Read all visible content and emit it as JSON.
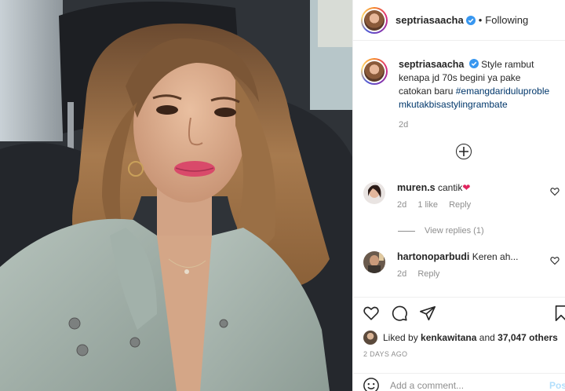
{
  "post": {
    "author": "septriasaacha",
    "verified": true,
    "follow_status": "Following",
    "separator": "•",
    "caption_text": "Style rambut kenapa jd 70s begini ya pake catokan baru",
    "caption_hashtag": "#emangdariduluproblemkutakbisastylingrambate",
    "caption_time": "2d",
    "load_more_icon": "plus-circle-icon"
  },
  "comments": [
    {
      "username": "muren.s",
      "text": "cantik",
      "emoji": "❤",
      "time": "2d",
      "likes": "1 like",
      "reply_label": "Reply",
      "view_replies": "View replies (1)"
    },
    {
      "username": "hartonoparbudi",
      "text": "Keren ah...",
      "time": "2d",
      "reply_label": "Reply"
    }
  ],
  "actions": {
    "icons": [
      "heart-icon",
      "comment-icon",
      "share-icon",
      "bookmark-icon"
    ],
    "liked_prefix": "Liked by",
    "liked_user": "kenkawitana",
    "liked_and": "and",
    "liked_others": "37,047 others",
    "time_ago": "2 DAYS AGO",
    "comment_placeholder": "Add a comment...",
    "post_label": "Post"
  },
  "colors": {
    "link": "#00376b",
    "muted": "#8e8e8e",
    "post_button": "#b2dffc",
    "verified": "#3897f0",
    "heart_emoji": "#e0245e"
  }
}
